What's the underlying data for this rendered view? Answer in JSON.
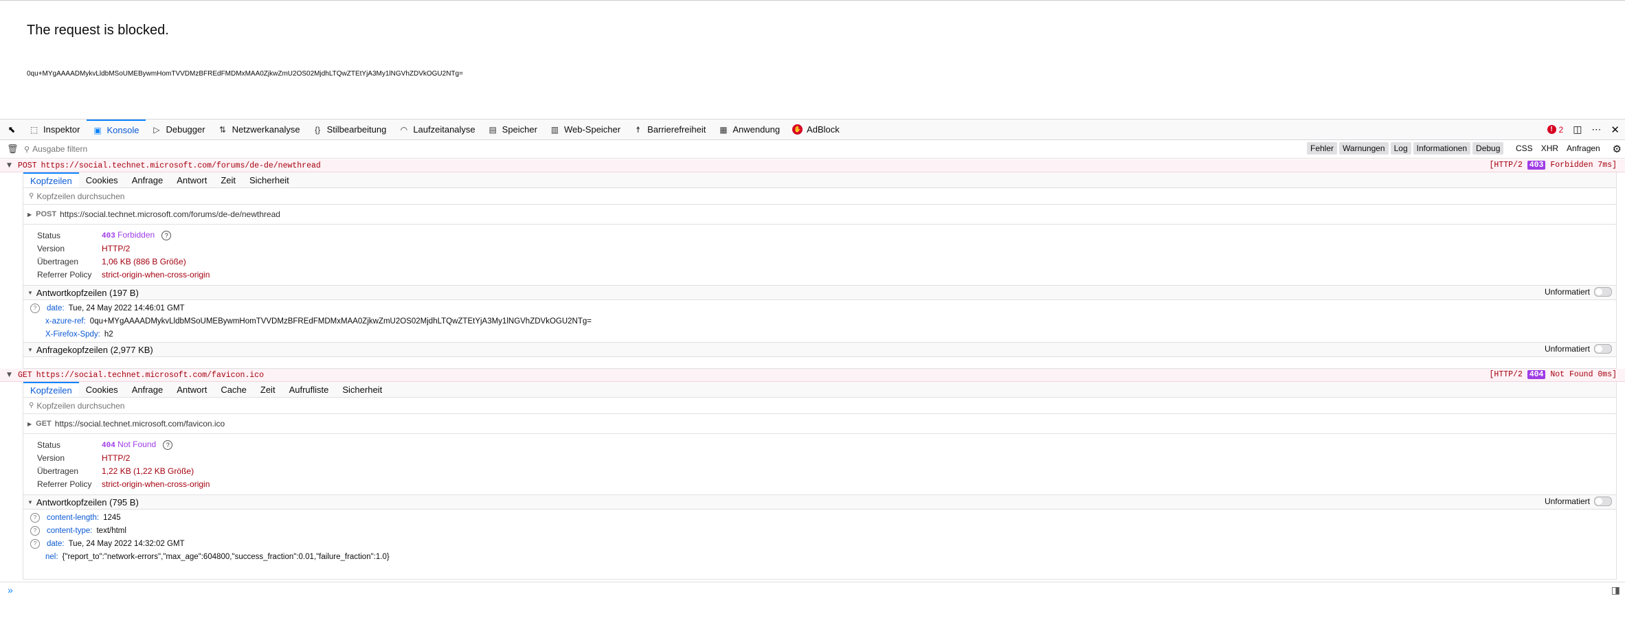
{
  "page": {
    "heading": "The request is blocked.",
    "code": "0qu+MYgAAAADMykvLldbMSoUMEBywmHomTVVDMzBFREdFMDMxMAA0ZjkwZmU2OS02MjdhLTQwZTEtYjA3My1lNGVhZDVkOGU2NTg="
  },
  "toolbar": {
    "tabs": [
      {
        "label": "Inspektor",
        "icon": "inspector-icon",
        "glyph": "⬚"
      },
      {
        "label": "Konsole",
        "icon": "console-icon",
        "glyph": "▣"
      },
      {
        "label": "Debugger",
        "icon": "debugger-icon",
        "glyph": "▷"
      },
      {
        "label": "Netzwerkanalyse",
        "icon": "network-icon",
        "glyph": "⇅"
      },
      {
        "label": "Stilbearbeitung",
        "icon": "style-editor-icon",
        "glyph": "{}"
      },
      {
        "label": "Laufzeitanalyse",
        "icon": "performance-icon",
        "glyph": "◠"
      },
      {
        "label": "Speicher",
        "icon": "memory-icon",
        "glyph": "▤"
      },
      {
        "label": "Web-Speicher",
        "icon": "storage-icon",
        "glyph": "▥"
      },
      {
        "label": "Barrierefreiheit",
        "icon": "accessibility-icon",
        "glyph": "☨"
      },
      {
        "label": "Anwendung",
        "icon": "application-icon",
        "glyph": "▦"
      },
      {
        "label": "AdBlock",
        "icon": "adblock-icon",
        "glyph": "✋"
      }
    ],
    "error_count": "2"
  },
  "filter": {
    "placeholder": "Ausgabe filtern",
    "levels": [
      "Fehler",
      "Warnungen",
      "Log",
      "Informationen",
      "Debug"
    ],
    "types": [
      "CSS",
      "XHR",
      "Anfragen"
    ]
  },
  "requests": [
    {
      "method": "POST",
      "url": "https://social.technet.microsoft.com/forums/de-de/newthread",
      "protocol": "[HTTP/2",
      "status_code": "403",
      "status_text": "Forbidden 7ms]",
      "tabs": [
        "Kopfzeilen",
        "Cookies",
        "Anfrage",
        "Antwort",
        "Zeit",
        "Sicherheit"
      ],
      "search_placeholder": "Kopfzeilen durchsuchen",
      "summary": {
        "status_label": "Status",
        "status_code": "403",
        "status_text": "Forbidden",
        "version_label": "Version",
        "version": "HTTP/2",
        "transferred_label": "Übertragen",
        "transferred": "1,06 KB (886 B Größe)",
        "referrer_label": "Referrer Policy",
        "referrer": "strict-origin-when-cross-origin"
      },
      "response_headers_title": "Antwortkopfzeilen (197 B)",
      "response_headers": [
        {
          "name": "date:",
          "value": "Tue, 24 May 2022 14:46:01 GMT",
          "help": true
        },
        {
          "name": "x-azure-ref:",
          "value": "0qu+MYgAAAADMykvLldbMSoUMEBywmHomTVVDMzBFREdFMDMxMAA0ZjkwZmU2OS02MjdhLTQwZTEtYjA3My1lNGVhZDVkOGU2NTg=",
          "help": false
        },
        {
          "name": "X-Firefox-Spdy:",
          "value": "h2",
          "help": false
        }
      ],
      "request_headers_title": "Anfragekopfzeilen (2,977 KB)"
    },
    {
      "method": "GET",
      "url": "https://social.technet.microsoft.com/favicon.ico",
      "protocol": "[HTTP/2",
      "status_code": "404",
      "status_text": "Not Found 0ms]",
      "tabs": [
        "Kopfzeilen",
        "Cookies",
        "Anfrage",
        "Antwort",
        "Cache",
        "Zeit",
        "Aufrufliste",
        "Sicherheit"
      ],
      "search_placeholder": "Kopfzeilen durchsuchen",
      "summary": {
        "status_label": "Status",
        "status_code": "404",
        "status_text": "Not Found",
        "version_label": "Version",
        "version": "HTTP/2",
        "transferred_label": "Übertragen",
        "transferred": "1,22 KB (1,22 KB Größe)",
        "referrer_label": "Referrer Policy",
        "referrer": "strict-origin-when-cross-origin"
      },
      "response_headers_title": "Antwortkopfzeilen (795 B)",
      "response_headers": [
        {
          "name": "content-length:",
          "value": "1245",
          "help": true
        },
        {
          "name": "content-type:",
          "value": "text/html",
          "help": true
        },
        {
          "name": "date:",
          "value": "Tue, 24 May 2022 14:32:02 GMT",
          "help": true
        },
        {
          "name": "nel:",
          "value": "{\"report_to\":\"network-errors\",\"max_age\":604800,\"success_fraction\":0.01,\"failure_fraction\":1.0}",
          "help": false
        }
      ]
    }
  ],
  "raw_toggle_label": "Unformatiert"
}
